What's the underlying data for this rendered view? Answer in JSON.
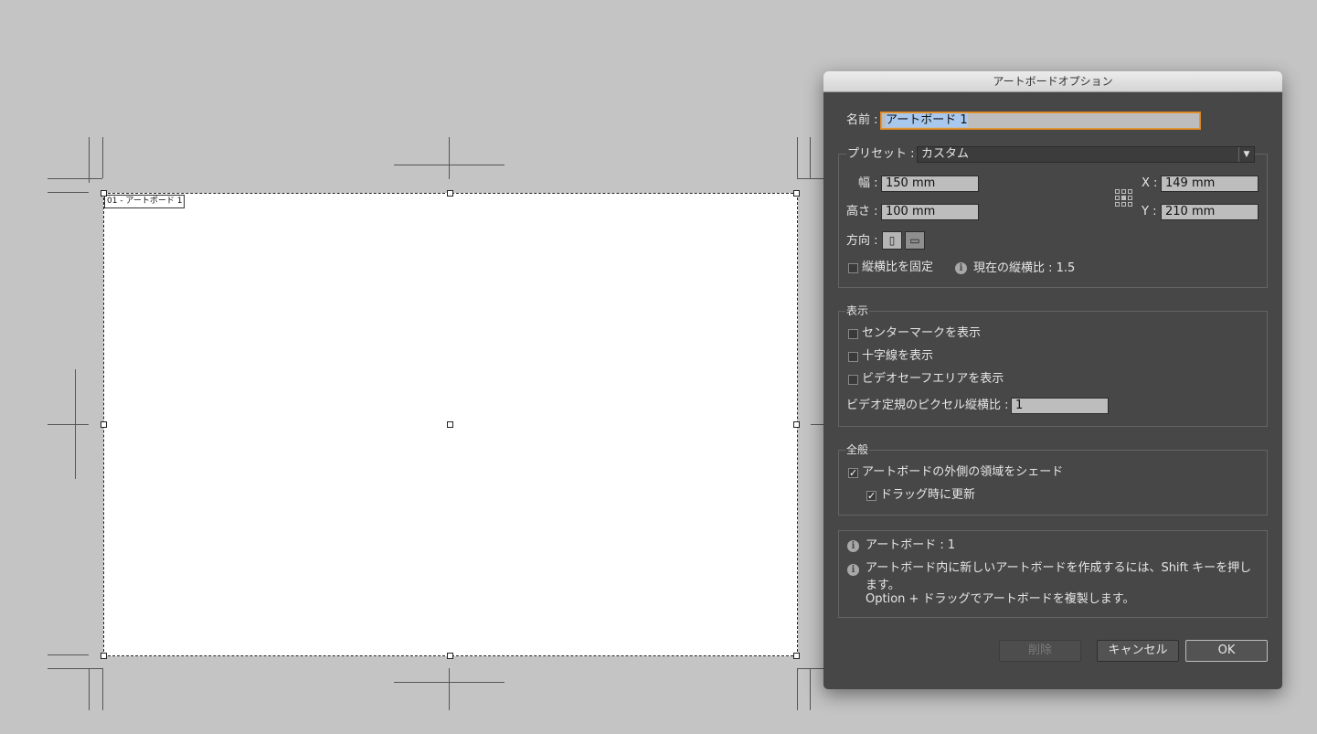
{
  "canvas": {
    "artboard_label": "01 - アートボード 1"
  },
  "dialog": {
    "title": "アートボードオプション",
    "name_label": "名前 :",
    "name_value": "アートボード 1",
    "preset_label": "プリセット :",
    "preset_value": "カスタム",
    "width_label": "幅 :",
    "width_value": "150 mm",
    "height_label": "高さ :",
    "height_value": "100 mm",
    "x_label": "X :",
    "x_value": "149 mm",
    "y_label": "Y :",
    "y_value": "210 mm",
    "orientation_label": "方向 :",
    "constrain_label": "縦横比を固定",
    "constrain_checked": false,
    "ratio_text": "現在の縦横比 : 1.5",
    "display": {
      "title": "表示",
      "center_mark": "センターマークを表示",
      "cross_hairs": "十字線を表示",
      "video_safe": "ビデオセーフエリアを表示",
      "pixel_ratio_label": "ビデオ定規のピクセル縦横比 :",
      "pixel_ratio_value": "1"
    },
    "general": {
      "title": "全般",
      "fade_outside": "アートボードの外側の領域をシェード",
      "update_drag": "ドラッグ時に更新"
    },
    "info": {
      "artboards": "アートボード : 1",
      "hint_line1": "アートボード内に新しいアートボードを作成するには、Shift キーを押し",
      "hint_line2": "ます。",
      "hint_line3": "Option + ドラッグでアートボードを複製します。"
    },
    "buttons": {
      "delete": "削除",
      "cancel": "キャンセル",
      "ok": "OK"
    }
  }
}
